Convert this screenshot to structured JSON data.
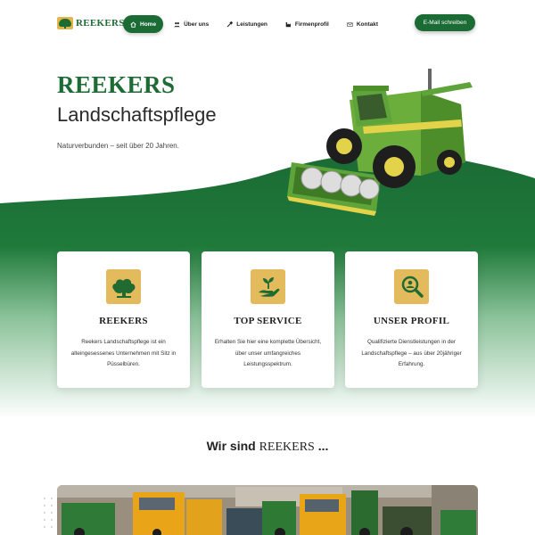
{
  "nav": {
    "logo_text": "REEKERS",
    "items": [
      {
        "label": "Home",
        "icon": "home-icon",
        "active": true
      },
      {
        "label": "Über uns",
        "icon": "users-icon",
        "active": false
      },
      {
        "label": "Leistungen",
        "icon": "tools-icon",
        "active": false
      },
      {
        "label": "Firmenprofil",
        "icon": "factory-icon",
        "active": false
      },
      {
        "label": "Kontakt",
        "icon": "mail-icon",
        "active": false
      }
    ],
    "cta_label": "E-Mail schreiben"
  },
  "hero": {
    "title": "REEKERS",
    "subtitle": "Landschaftspflege",
    "tagline": "Naturverbunden – seit über 20 Jahren."
  },
  "cards": [
    {
      "icon": "tree-icon",
      "title": "REEKERS",
      "text": "Reekers Landschaftspflege ist ein alteingesessenes Unternehmen mit Sitz in Püsselbüren."
    },
    {
      "icon": "hand-plant-icon",
      "title": "TOP SERVICE",
      "text": "Erhalten Sie hier eine komplette Übersicht, über unser umfangreiches Leistungsspektrum."
    },
    {
      "icon": "search-person-icon",
      "title": "UNSER PROFIL",
      "text": "Qualifizierte Dienstleistungen in der Landschaftspflege – aus über 20jähriger Erfahrung."
    }
  ],
  "about": {
    "heading_prefix": "Wir sind ",
    "heading_brand": "REEKERS",
    "heading_suffix": " ..."
  },
  "colors": {
    "brand_green": "#1b6b34",
    "accent_gold": "#e3bb5c"
  }
}
